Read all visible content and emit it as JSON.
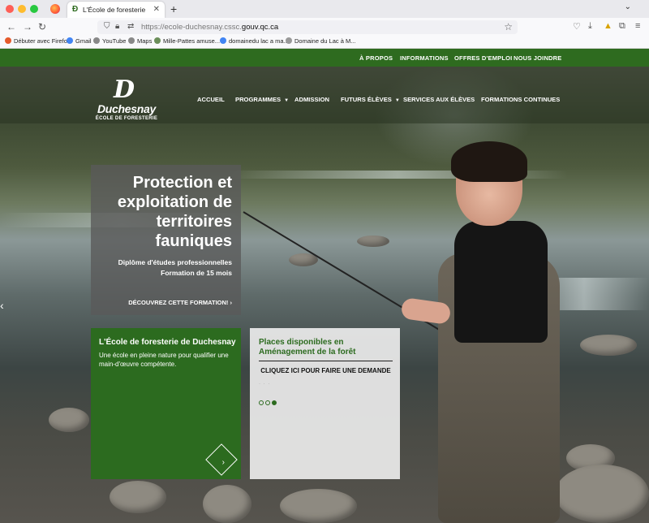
{
  "browser": {
    "tab_title": "L'École de foresterie de Duches",
    "tab_favicon": "duchesnay-d",
    "new_tab": "+",
    "url_prefix": "https://ecole-duchesnay.cssc.",
    "url_domain": "gouv.qc.ca",
    "bookmarks": [
      "Débuter avec Firefox",
      "Gmail",
      "YouTube",
      "Maps",
      "Mille-Pattes amuse...",
      "domainedu lac a ma...",
      "Domaine du Lac à M..."
    ]
  },
  "site": {
    "top_links": [
      "À PROPOS",
      "INFORMATIONS",
      "OFFRES D'EMPLOI",
      "NOUS JOINDRE"
    ],
    "logo": {
      "mark": "D",
      "name": "Duchesnay",
      "subtitle": "ÉCOLE DE FORESTERIE"
    },
    "main_nav": [
      {
        "label": "ACCUEIL"
      },
      {
        "label": "PROGRAMMES"
      },
      {
        "label": "ADMISSION"
      },
      {
        "label": "FUTURS ÉLÈVES"
      },
      {
        "label": "SERVICES AUX ÉLÈVES"
      },
      {
        "label": "FORMATIONS CONTINUES"
      }
    ],
    "slide": {
      "title": "Protection et exploitation de territoires fauniques",
      "subtitle_line1": "Diplôme d'études professionnelles",
      "subtitle_line2": "Formation de 15 mois",
      "cta": "DÉCOUVREZ CETTE FORMATION! ›"
    },
    "card_green": {
      "title": "L'École de foresterie de Duchesnay",
      "text": "Une école en pleine nature pour qualifier une main-d'œuvre compétente."
    },
    "card_white": {
      "title": "Places disponibles en Aménagement de la forêt",
      "link": "CLIQUEZ ICI POUR FAIRE UNE DEMANDE",
      "active_dot": 3,
      "dot_count": 3
    }
  },
  "colors": {
    "brand_green": "#2e6b1f",
    "card_green": "#2c6b1f"
  }
}
